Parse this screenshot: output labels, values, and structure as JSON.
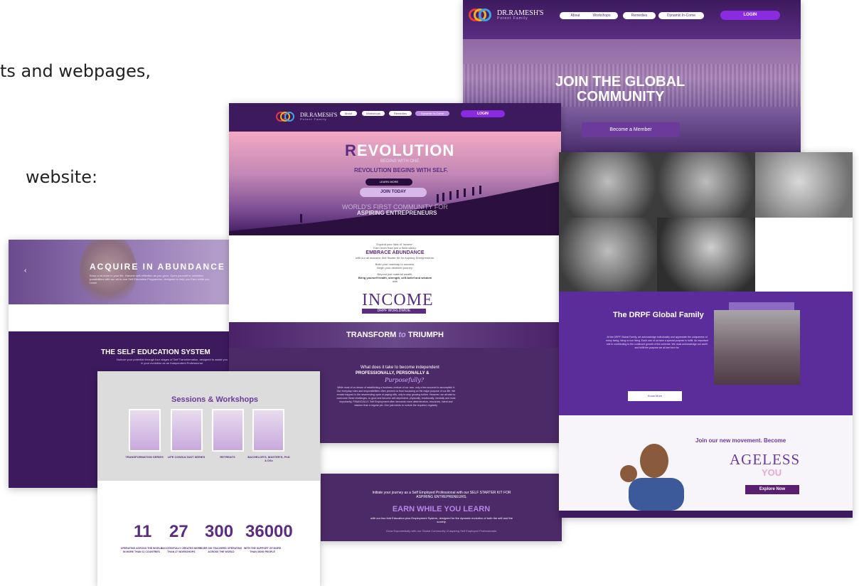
{
  "captions": {
    "line1": "ts and webpages,",
    "line2": "website:"
  },
  "nav": {
    "brand": "DR.RAMESH'S",
    "brand_sub": "Potent Family",
    "items": [
      "About",
      "Workshops",
      "Remedies",
      "Dynamic In-Come"
    ],
    "login": "LOGIN"
  },
  "community": {
    "title_line1": "JOIN THE GLOBAL",
    "title_line2": "COMMUNITY",
    "cta": "Become a Member"
  },
  "revolution": {
    "title_first": "R",
    "title_rest": "EVOLUTION",
    "line1": "BEGINS WITH ONE.",
    "line2": "REVOLUTION BEGINS WITH SELF.",
    "learn_more": "LEARN MORE",
    "join_today": "JOIN TODAY",
    "line3": "WORLD'S FIRST COMMUNITY FOR",
    "line4": "ASPIRING ENTREPRENEURS",
    "intro": {
      "a": "Expand your idea of 'income'.",
      "b": "Earn more than just a fixed salary.",
      "c": "EMBRACE ABUNDANCE",
      "d": "with our all inclusive Self Starter Kit for Aspiring Entrepreneurs.",
      "e": "Build your roadmap to success.",
      "f": "Begin your destined journey.",
      "g": "Beyond just material wealth,",
      "h": "Bring yourself health, strength, self-belief and wisdom",
      "i": "with"
    },
    "income_word": "INCOME",
    "income_bar": "DRPF WORLDWIDE",
    "transform_a": "TRANSFORM",
    "transform_to": "to",
    "transform_b": "TRIUMPH",
    "q1": "What does it take to become independent",
    "q2": "PROFESSIONALLY, PERSONALLY &",
    "q3": "Purposefully?",
    "para": "While most of us dream of establishing a business venture of our own, only a few succeed to accomplish it. Our everyday roles and responsibilities often prevent us from focussing on the major purpose of our life. We remain trapped in the neverending cycle of paying bills, only to stop growing further. However, we all wish to overcome these challenges, to grow and become self-dependent, physically, emotionally, mentally and most importantly, FINANCIALLY. Self Employment often demands more determination, resources, intent and wisdom than a regular job. One just needs to nurture the required, regularly."
  },
  "acquire": {
    "title": "ACQUIRE IN ABUNDANCE",
    "sub": "Keep a lot more in your life. Harvest self-reflection as you grow. Open yourself to unlimited possibilities with our all-in-one Self Education Programme, designed to help you Earn while you Learn.",
    "system_title": "THE SELF EDUCATION SYSTEM",
    "system_sub": "Nurture your potential through four stages of Self Transformation, designed to assist you in your evolution as an Independent Professional."
  },
  "sessions": {
    "title": "Sessions & Workshops",
    "tiles": [
      {
        "label": "TRANSFORMATION SERIES"
      },
      {
        "label": "LIFE CONSULTANT SERIES"
      },
      {
        "label": "RETREATS"
      },
      {
        "label": "BACHELOR'S, MASTER'S, PhD & DSc"
      }
    ],
    "stats": [
      {
        "value": "11",
        "label": "OPERATING ACROSS THE WORLD IN MORE THAN 11 COUNTRIES"
      },
      {
        "value": "27",
        "label": "SUCCESSFULLY CREATED MORE THAN 27 WORKSHOPS"
      },
      {
        "value": "300",
        "label": "OVER 300 TEACHERS OPERATING ACROSS THE WORLD"
      },
      {
        "value": "36000",
        "label": "WITH THE SUPPORT OF MORE THAN 36000 PEOPLE"
      }
    ]
  },
  "family": {
    "title": "The DRPF Global Family",
    "text": "At the DRPF Global Family, we acknowledge individuality and appreciate the uniqueness of every being, living or non living. Each one of us have a special purpose to fulfill. An important role in contributing to the continued growth of the universe. We must acknowledge our worth and fulfill the purpose we all are born for.",
    "know_more": "Know More",
    "join_movement": "Join our new movement. Become",
    "ageless": "AGELESS",
    "you": "YOU",
    "explore": "Explore Now"
  },
  "earn": {
    "t1": "Initiate your journey as a Self Employed Professional with our SELF STARTER KIT FOR ASPIRING ENTREPRENEURS.",
    "t2": "EARN WHILE YOU LEARN",
    "t3": "with our two fold Education plus Employment System, designed for the dynamic evolution of both the self and the society.",
    "t4": "Grow Exponentially with our Global Community of aspiring Self Employed Professionals."
  }
}
